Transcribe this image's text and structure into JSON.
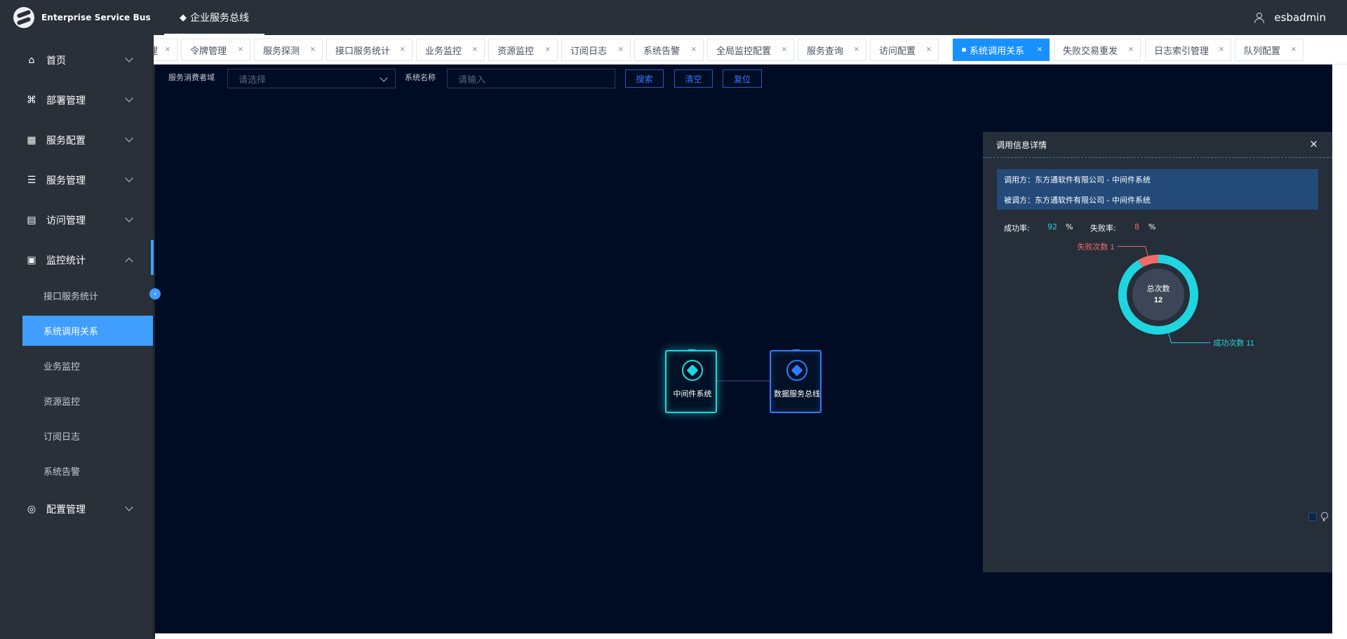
{
  "app": {
    "name": "Enterprise Service Bus",
    "top_menu": "企业服务总线",
    "user": "esbadmin"
  },
  "sidebar": {
    "groups": [
      {
        "label": "首页",
        "icon": "home-icon",
        "expanded": false
      },
      {
        "label": "部署管理",
        "icon": "deploy-icon",
        "expanded": false
      },
      {
        "label": "服务配置",
        "icon": "grid-icon",
        "expanded": false
      },
      {
        "label": "服务管理",
        "icon": "list-icon",
        "expanded": false
      },
      {
        "label": "访问管理",
        "icon": "message-icon",
        "expanded": false
      },
      {
        "label": "监控统计",
        "icon": "monitor-icon",
        "expanded": true
      },
      {
        "label": "配置管理",
        "icon": "settings-icon",
        "expanded": false
      }
    ],
    "monitor_items": [
      "接口服务统计",
      "系统调用关系",
      "业务监控",
      "资源监控",
      "订阅日志",
      "系统告警"
    ],
    "active_item": "系统调用关系"
  },
  "tabs": [
    {
      "label": "理",
      "active": false
    },
    {
      "label": "令牌管理",
      "active": false
    },
    {
      "label": "服务探测",
      "active": false
    },
    {
      "label": "接口服务统计",
      "active": false
    },
    {
      "label": "业务监控",
      "active": false
    },
    {
      "label": "资源监控",
      "active": false
    },
    {
      "label": "订阅日志",
      "active": false
    },
    {
      "label": "系统告警",
      "active": false
    },
    {
      "label": "全局监控配置",
      "active": false
    },
    {
      "label": "服务查询",
      "active": false
    },
    {
      "label": "访问配置",
      "active": false
    },
    {
      "label": "系统调用关系",
      "active": true
    },
    {
      "label": "失败交易重发",
      "active": false
    },
    {
      "label": "日志索引管理",
      "active": false
    },
    {
      "label": "队列配置",
      "active": false
    }
  ],
  "filters": {
    "consumer_domain_label": "服务消费者域",
    "consumer_domain_placeholder": "请选择",
    "system_name_label": "系统名称",
    "system_name_placeholder": "请输入",
    "search_button": "搜索",
    "clear_button": "清空",
    "reset_button": "复位"
  },
  "graph": {
    "nodes": [
      {
        "label": "中间件系统",
        "color": "#1fd6e0"
      },
      {
        "label": "数据服务总线",
        "color": "#2f7bff"
      }
    ]
  },
  "detail_panel": {
    "title": "调用信息详情",
    "caller": "调用方：东方通软件有限公司 - 中间件系统",
    "callee": "被调方：东方通软件有限公司 - 中间件系统",
    "success_rate_label": "成功率:",
    "success_rate": "92",
    "failure_rate_label": "失败率:",
    "failure_rate": "8",
    "percent": "%",
    "success_color": "#1fd6e0",
    "failure_color": "#f06a6a"
  },
  "chart_data": {
    "type": "pie",
    "center_label": "总次数",
    "total": 12,
    "slices": [
      {
        "name": "失败次数",
        "value": 1,
        "color": "#f06a6a"
      },
      {
        "name": "成功次数",
        "value": 11,
        "color": "#1fd6e0"
      }
    ]
  }
}
